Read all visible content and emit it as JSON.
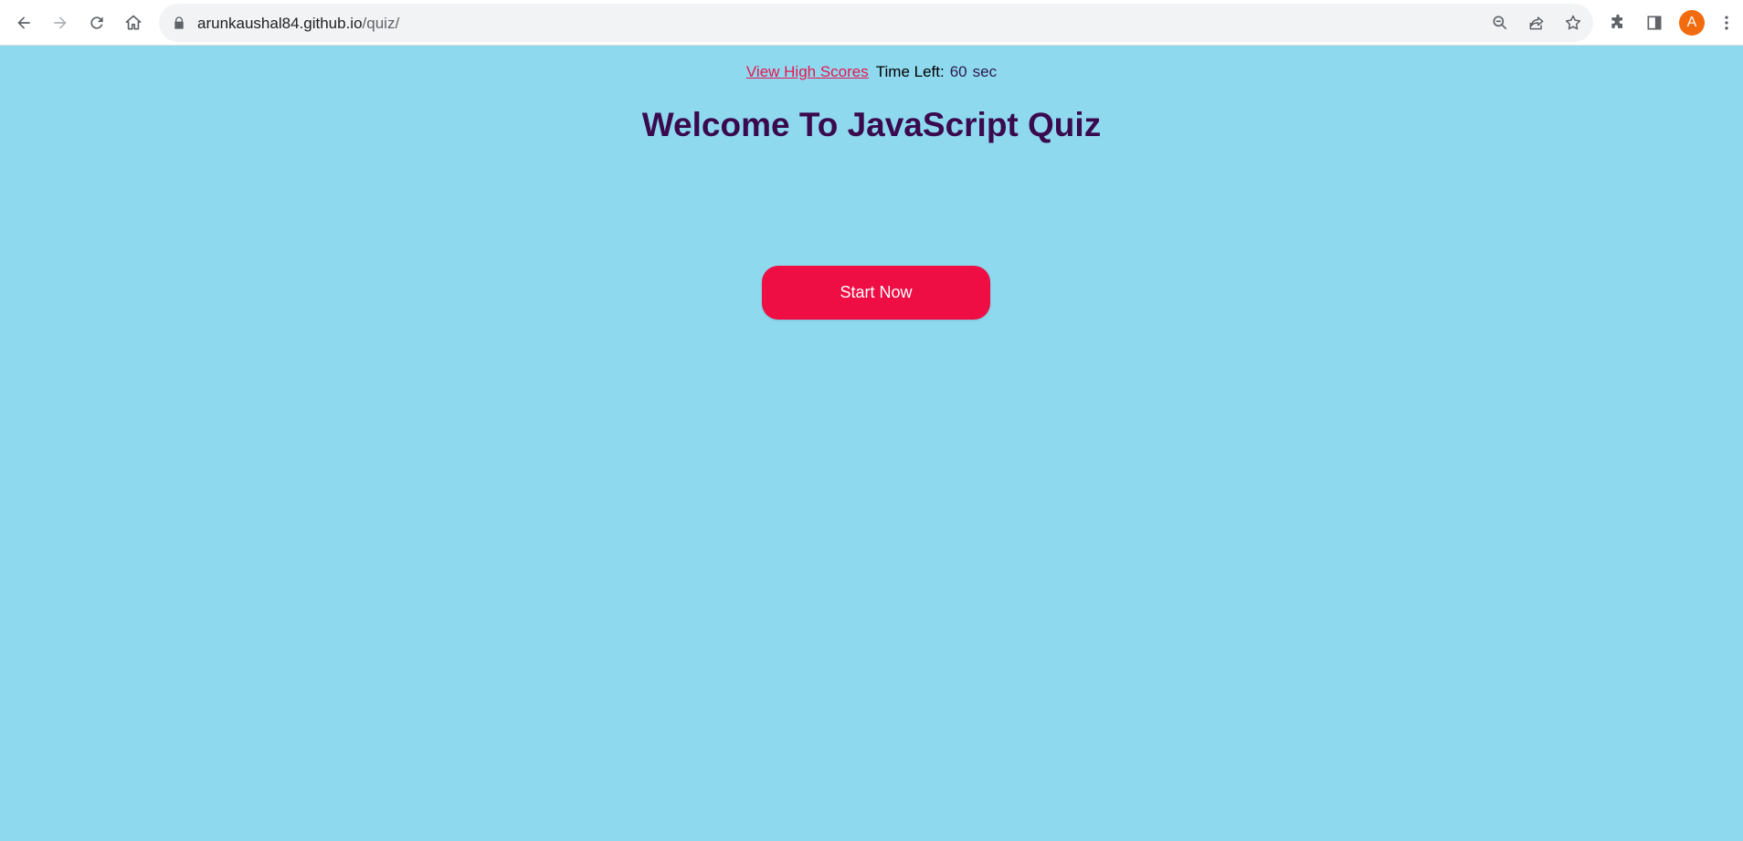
{
  "browser": {
    "url_host": "arunkaushal84.github.io",
    "url_path": "/quiz/",
    "avatar_letter": "A",
    "icons": [
      "back-icon",
      "forward-icon",
      "reload-icon",
      "home-icon",
      "lock-icon",
      "zoom-icon",
      "share-icon",
      "star-icon",
      "extensions-icon",
      "side-panel-icon",
      "menu-icon"
    ]
  },
  "page": {
    "high_scores_link": "View High Scores",
    "time_label": "Time Left:",
    "time_value": "60",
    "time_unit": "sec",
    "title": "Welcome To JavaScript Quiz",
    "start_button": "Start Now"
  },
  "colors": {
    "page_background": "#8fd9ef",
    "title": "#3a0a4f",
    "link": "#e8154f",
    "start_button": "#ee0e44",
    "avatar": "#f26b0f"
  }
}
